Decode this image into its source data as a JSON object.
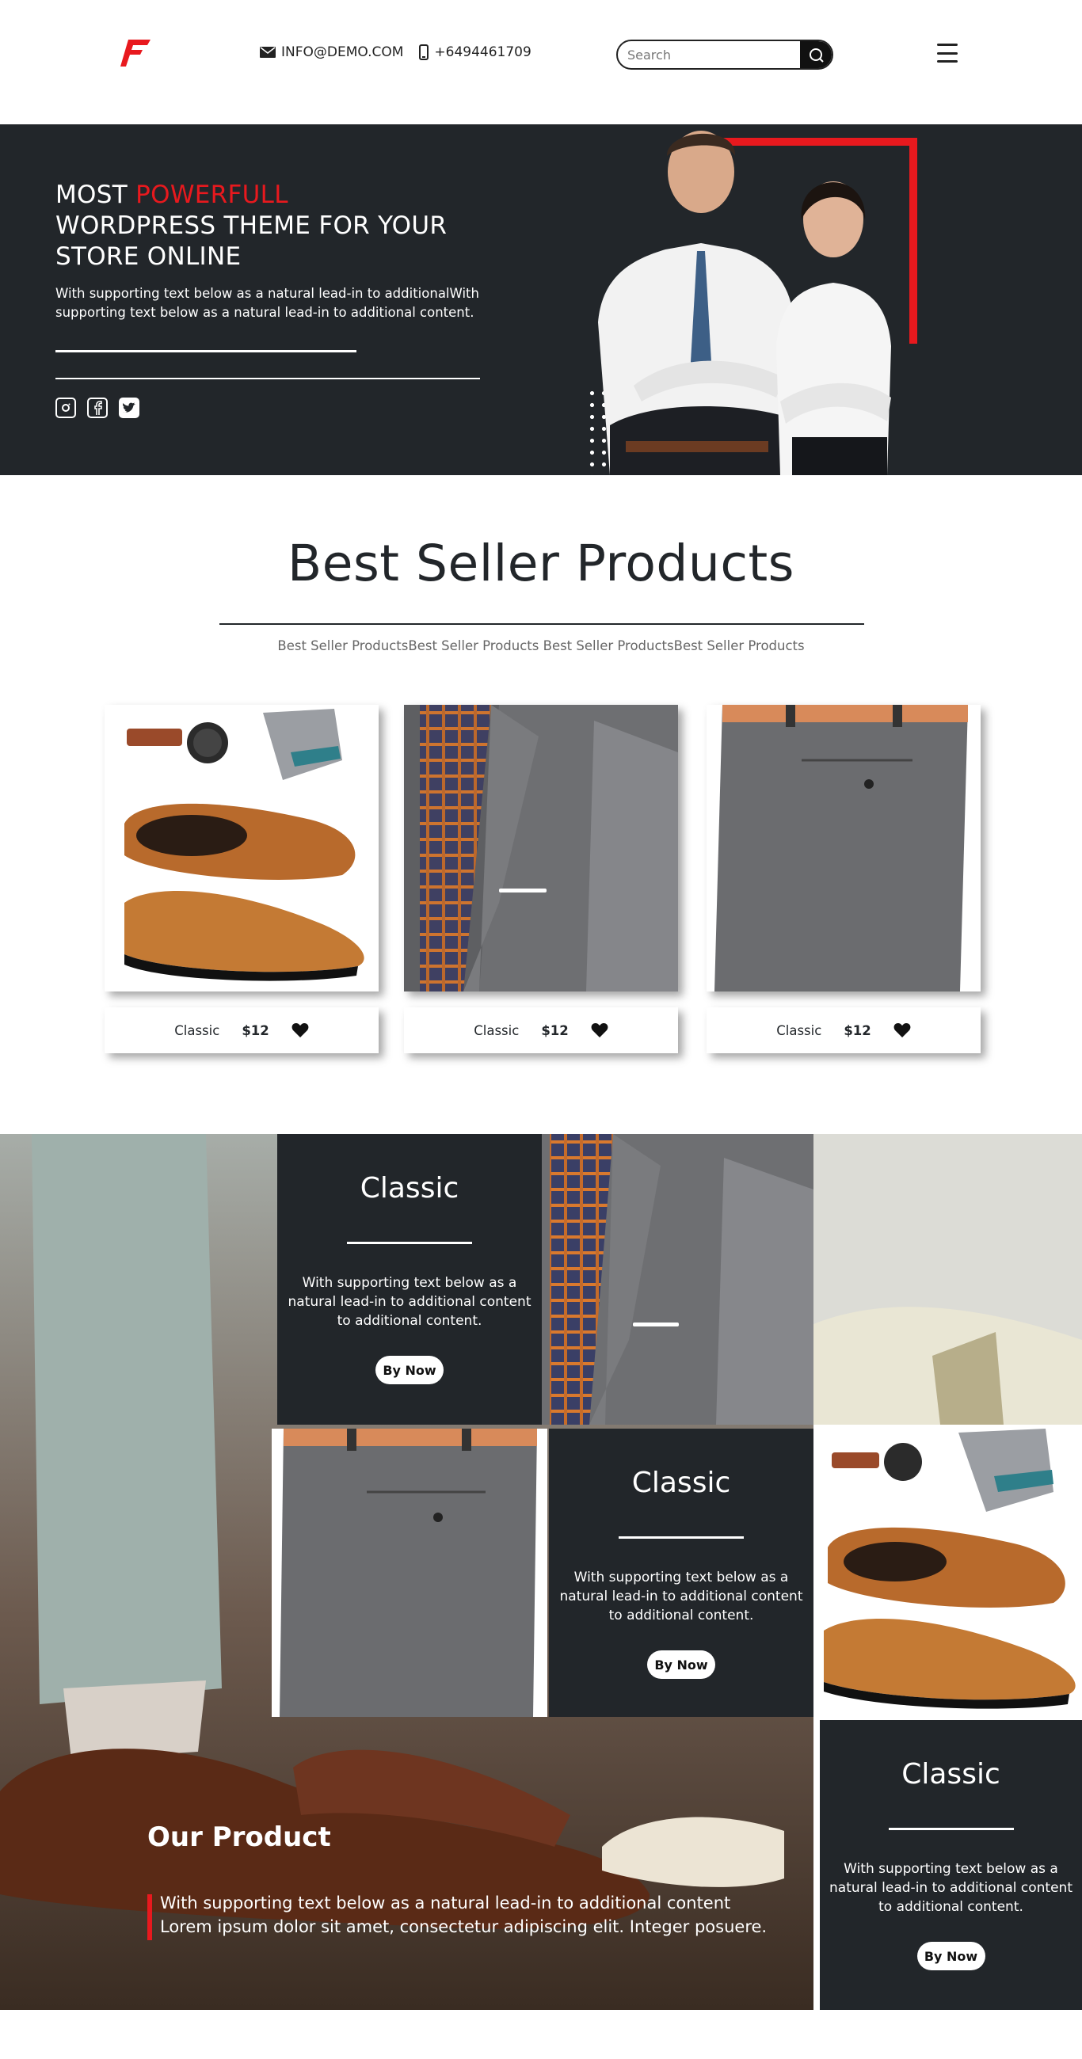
{
  "header": {
    "email": "INFO@DEMO.COM",
    "phone": "+6494461709",
    "search_placeholder": "Search"
  },
  "hero": {
    "title_prefix": "MOST ",
    "title_accent": "POWERFULL",
    "title_rest": "WORDPRESS THEME FOR YOUR STORE ONLINE",
    "text": "With supporting text below as a natural lead-in to additionalWith supporting text below as a natural lead-in to additional content.",
    "accent_color": "#e8191e",
    "social_icons": [
      "instagram-icon",
      "facebook-icon",
      "twitter-icon"
    ]
  },
  "best_seller": {
    "title": "Best Seller Products",
    "subtitle": "Best Seller ProductsBest Seller Products Best Seller ProductsBest Seller Products",
    "products": [
      {
        "name": "Classic",
        "price": "$12"
      },
      {
        "name": "Classic",
        "price": "$12"
      },
      {
        "name": "Classic",
        "price": "$12"
      }
    ]
  },
  "promos": [
    {
      "title": "Classic",
      "text": "With supporting text below as a natural lead-in to additional content to additional content.",
      "button": "By Now"
    },
    {
      "title": "Classic",
      "text": "With supporting text below as a natural lead-in to additional content to additional content.",
      "button": "By Now"
    },
    {
      "title": "Classic",
      "text": "With supporting text below as a natural lead-in to additional content to additional content.",
      "button": "By Now"
    }
  ],
  "our_product": {
    "title": "Our Product",
    "line1": "With supporting text below as a natural lead-in to additional content",
    "line2": "Lorem ipsum dolor sit amet, consectetur adipiscing elit. Integer posuere."
  }
}
